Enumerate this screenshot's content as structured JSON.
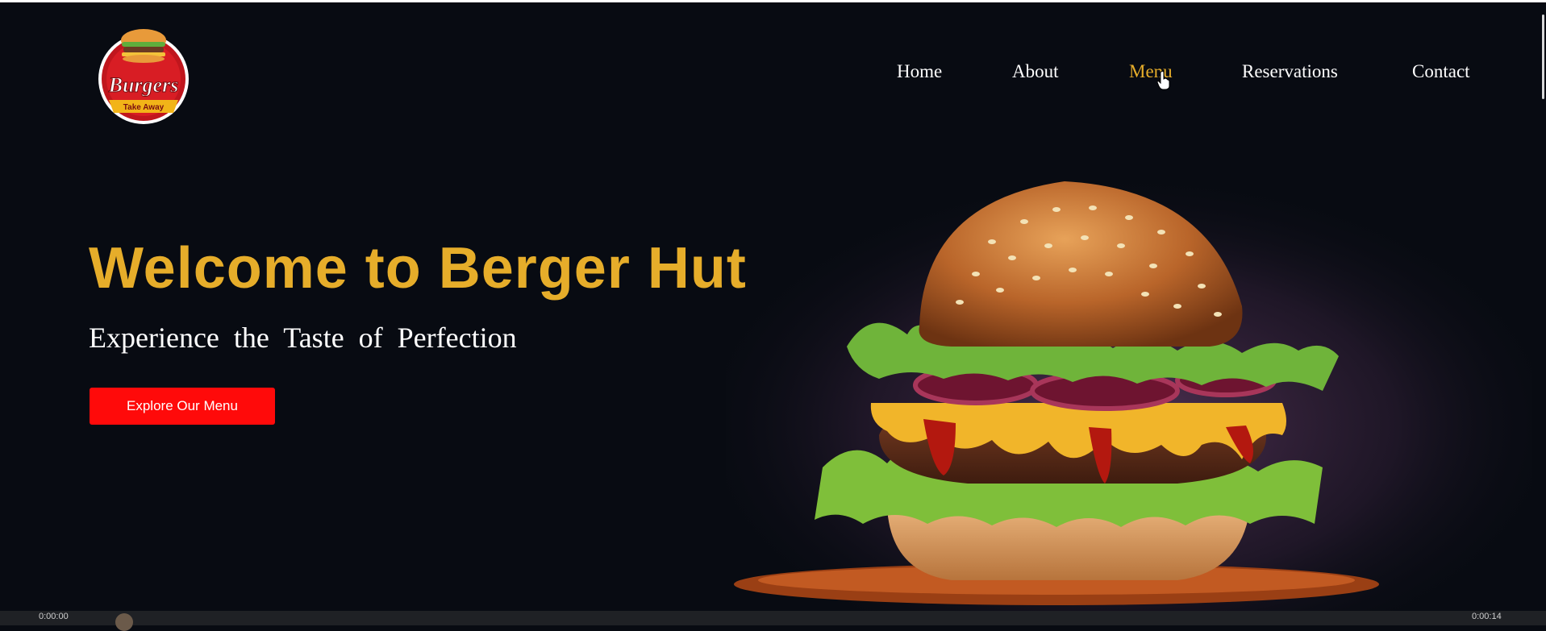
{
  "brand": {
    "logo_text": "Burgers",
    "logo_ribbon": "Take Away"
  },
  "nav": {
    "items": [
      {
        "label": "Home"
      },
      {
        "label": "About"
      },
      {
        "label": "Menu"
      },
      {
        "label": "Reservations"
      },
      {
        "label": "Contact"
      }
    ],
    "active": "Menu"
  },
  "hero": {
    "title": "Welcome to Berger Hut",
    "subtitle": "Experience the Taste of Perfection",
    "cta_label": "Explore Our Menu"
  },
  "colors": {
    "background": "#080b12",
    "accent": "#e6ad2a",
    "button": "#ff0a0a"
  },
  "icons": {
    "cursor": "pointer-hand-icon"
  },
  "bottom_bar": {
    "left_text": "0:00:00",
    "right_text": "0:00:14"
  }
}
